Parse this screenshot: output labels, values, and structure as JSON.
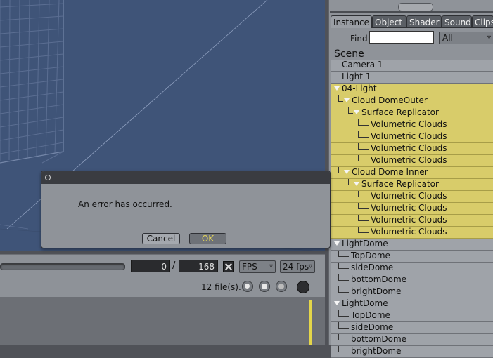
{
  "timeline": {
    "current_frame": "0",
    "separator": "/",
    "end_frame": "168",
    "fps_mode": "FPS",
    "fps_rate": "24 fps"
  },
  "files_bar": {
    "count": "12 file(s)."
  },
  "right_panel": {
    "tabs": [
      "Instance",
      "Object",
      "Shader",
      "Sound",
      "Clips"
    ],
    "find_label": "Find:",
    "find_value": "",
    "find_filter": "All",
    "scene_heading": "Scene",
    "items": [
      {
        "label": "Camera 1",
        "depth": 0,
        "expanded": false,
        "selected": false
      },
      {
        "label": "Light 1",
        "depth": 0,
        "expanded": false,
        "selected": false
      },
      {
        "label": "04-Light",
        "depth": 0,
        "expanded": true,
        "selected": true
      },
      {
        "label": "Cloud DomeOuter",
        "depth": 1,
        "expanded": true,
        "selected": true
      },
      {
        "label": "Surface Replicator",
        "depth": 2,
        "expanded": true,
        "selected": true
      },
      {
        "label": "Volumetric Clouds",
        "depth": 3,
        "expanded": false,
        "selected": true
      },
      {
        "label": "Volumetric Clouds",
        "depth": 3,
        "expanded": false,
        "selected": true
      },
      {
        "label": "Volumetric Clouds",
        "depth": 3,
        "expanded": false,
        "selected": true
      },
      {
        "label": "Volumetric Clouds",
        "depth": 3,
        "expanded": false,
        "selected": true
      },
      {
        "label": "Cloud Dome Inner",
        "depth": 1,
        "expanded": true,
        "selected": true
      },
      {
        "label": "Surface Replicator",
        "depth": 2,
        "expanded": true,
        "selected": true
      },
      {
        "label": "Volumetric Clouds",
        "depth": 3,
        "expanded": false,
        "selected": true
      },
      {
        "label": "Volumetric Clouds",
        "depth": 3,
        "expanded": false,
        "selected": true
      },
      {
        "label": "Volumetric Clouds",
        "depth": 3,
        "expanded": false,
        "selected": true
      },
      {
        "label": "Volumetric Clouds",
        "depth": 3,
        "expanded": false,
        "selected": true
      },
      {
        "label": "LightDome",
        "depth": 0,
        "expanded": true,
        "selected": false
      },
      {
        "label": "TopDome",
        "depth": 1,
        "expanded": false,
        "selected": false
      },
      {
        "label": "sideDome",
        "depth": 1,
        "expanded": false,
        "selected": false
      },
      {
        "label": "bottomDome",
        "depth": 1,
        "expanded": false,
        "selected": false
      },
      {
        "label": "brightDome",
        "depth": 1,
        "expanded": false,
        "selected": false
      },
      {
        "label": "LightDome",
        "depth": 0,
        "expanded": true,
        "selected": false
      },
      {
        "label": "TopDome",
        "depth": 1,
        "expanded": false,
        "selected": false
      },
      {
        "label": "sideDome",
        "depth": 1,
        "expanded": false,
        "selected": false
      },
      {
        "label": "bottomDome",
        "depth": 1,
        "expanded": false,
        "selected": false
      },
      {
        "label": "brightDome",
        "depth": 1,
        "expanded": false,
        "selected": false
      }
    ]
  },
  "dialog": {
    "message": "An error has occurred.",
    "cancel_label": "Cancel",
    "ok_label": "OK"
  },
  "colors": {
    "viewport_bg": "#3f5478",
    "selection_highlight": "#d8cc6a",
    "ok_text": "#e3d45a"
  }
}
